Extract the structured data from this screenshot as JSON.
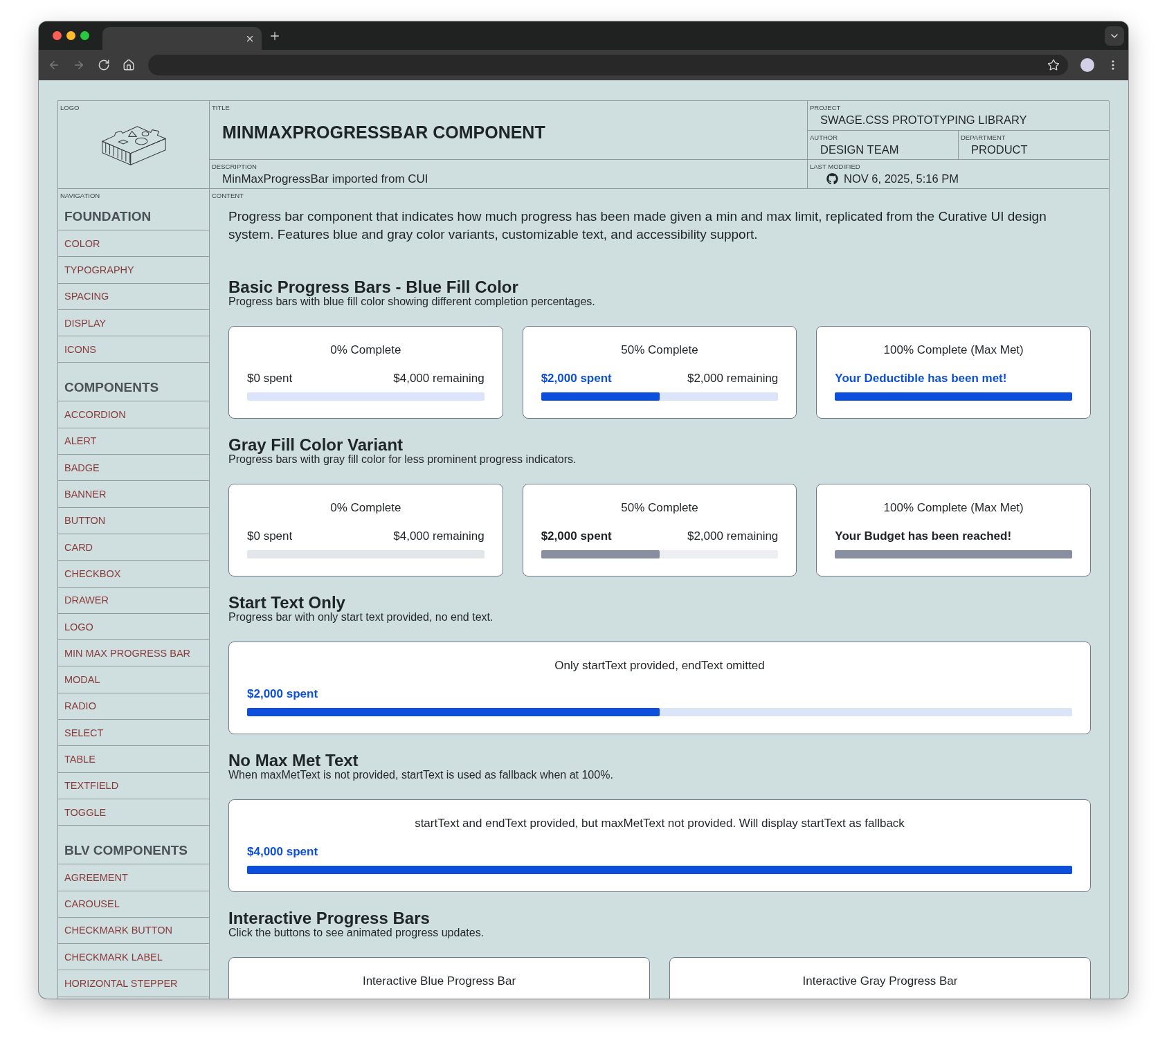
{
  "browser": {
    "nav_buttons": [
      {
        "kind": "back",
        "disabled": true
      },
      {
        "kind": "forward",
        "disabled": true
      },
      {
        "kind": "reload",
        "disabled": false
      },
      {
        "kind": "home",
        "disabled": false
      }
    ]
  },
  "header": {
    "logo_label": "LOGO",
    "title_label": "TITLE",
    "title": "MINMAXPROGRESSBAR COMPONENT",
    "project_label": "PROJECT",
    "project": "SWAGE.CSS PROTOTYPING LIBRARY",
    "author_label": "AUTHOR",
    "author": "DESIGN TEAM",
    "department_label": "DEPARTMENT",
    "department": "PRODUCT",
    "description_label": "DESCRIPTION",
    "description": "MinMaxProgressBar imported from CUI",
    "last_modified_label": "LAST MODIFIED",
    "last_modified": "NOV 6, 2025, 5:16 PM"
  },
  "navigation": {
    "label": "NAVIGATION",
    "groups": [
      {
        "heading": "FOUNDATION",
        "items": [
          "COLOR",
          "TYPOGRAPHY",
          "SPACING",
          "DISPLAY",
          "ICONS"
        ]
      },
      {
        "heading": "COMPONENTS",
        "items": [
          "ACCORDION",
          "ALERT",
          "BADGE",
          "BANNER",
          "BUTTON",
          "CARD",
          "CHECKBOX",
          "DRAWER",
          "LOGO",
          "MIN MAX PROGRESS BAR",
          "MODAL",
          "RADIO",
          "SELECT",
          "TABLE",
          "TEXTFIELD",
          "TOGGLE"
        ]
      },
      {
        "heading": "BLV COMPONENTS",
        "items": [
          "AGREEMENT",
          "CAROUSEL",
          "CHECKMARK BUTTON",
          "CHECKMARK LABEL",
          "HORIZONTAL STEPPER"
        ]
      }
    ]
  },
  "content": {
    "label": "CONTENT",
    "intro": "Progress bar component that indicates how much progress has been made given a min and max limit, replicated from the Curative UI design system. Features blue and gray color variants, customizable text, and accessibility support.",
    "sections": [
      {
        "heading": "Basic Progress Bars - Blue Fill Color",
        "subtitle": "Progress bars with blue fill color showing different completion percentages.",
        "cards": [
          {
            "title": "0% Complete",
            "color": "#dce4fb",
            "level": 0,
            "start_text": "$0 spent",
            "end_text": "$4,000 remaining"
          },
          {
            "title": "50% Complete",
            "color": "#0b4fdc",
            "level": 0.5,
            "start_text": "$2,000 spent",
            "end_text": "$2,000 remaining"
          },
          {
            "title": "100% Complete (Max Met)",
            "color": "#0b4fdc",
            "level": 1,
            "start_text": "Your Deductible has been met!"
          }
        ]
      },
      {
        "heading": "Gray Fill Color Variant",
        "subtitle": "Progress bars with gray fill color for less prominent progress indicators.",
        "cards": [
          {
            "title": "0% Complete",
            "color": "#e2e6ea",
            "level": 0,
            "start_text": "$0 spent",
            "end_text": "$4,000 remaining"
          },
          {
            "title": "50% Complete",
            "color": "#868e9f",
            "level": 0.5,
            "start_text": "$2,000 spent",
            "end_text": "$2,000 remaining"
          },
          {
            "title": "100% Complete (Max Met)",
            "color": "#868e9f",
            "level": 1,
            "start_text": "Your Budget has been reached!"
          }
        ]
      },
      {
        "heading": "Start Text Only",
        "subtitle": "Progress bar with only start text provided, no end text.",
        "cards": [
          {
            "title": "Only startText provided, endText omitted",
            "color": "#0b4fdc",
            "level": 0.5,
            "start_text": "$2,000 spent"
          }
        ]
      },
      {
        "heading": "No Max Met Text",
        "subtitle": "When maxMetText is not provided, startText is used as fallback when at 100%.",
        "cards": [
          {
            "title": "startText and endText provided, but maxMetText not provided. Will display startText as fallback",
            "color": "#0b4fdc",
            "level": 1,
            "start_text": "$4,000 spent"
          }
        ]
      },
      {
        "heading": "Interactive Progress Bars",
        "subtitle": "Click the buttons to see animated progress updates.",
        "cards": [
          {
            "title": "Interactive Blue Progress Bar"
          },
          {
            "title": "Interactive Gray Progress Bar"
          }
        ]
      }
    ]
  }
}
